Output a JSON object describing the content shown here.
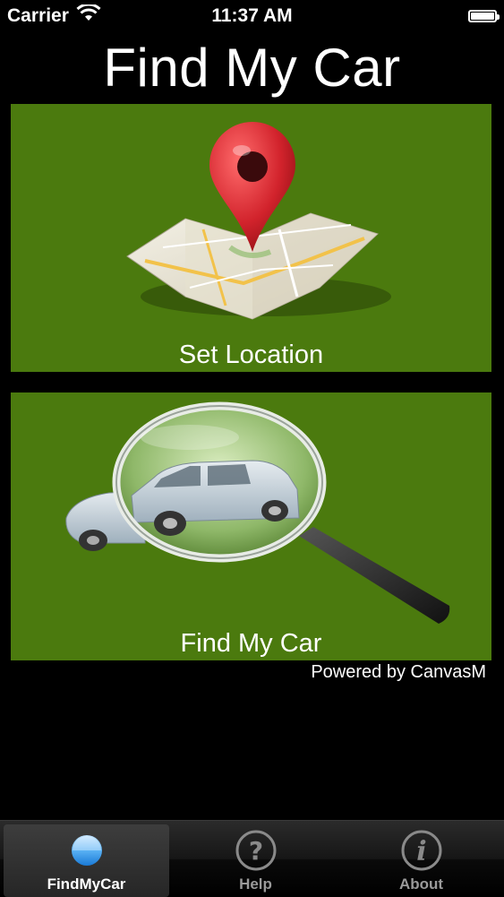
{
  "status_bar": {
    "carrier": "Carrier",
    "time": "11:37 AM"
  },
  "header": {
    "title": "Find My Car"
  },
  "tiles": [
    {
      "label": "Set Location",
      "icon": "map-pin-icon"
    },
    {
      "label": "Find My Car",
      "icon": "magnifier-car-icon"
    }
  ],
  "footer": {
    "powered_by": "Powered by CanvasM"
  },
  "tabbar": {
    "tabs": [
      {
        "label": "FindMyCar",
        "icon": "blue-dot-icon",
        "selected": true
      },
      {
        "label": "Help",
        "icon": "question-icon",
        "selected": false
      },
      {
        "label": "About",
        "icon": "info-icon",
        "selected": false
      }
    ]
  },
  "colors": {
    "background": "#000000",
    "tile": "#4b7a0e",
    "pin": "#d2232c",
    "tab_selected_dot": "#3aa0f0"
  }
}
